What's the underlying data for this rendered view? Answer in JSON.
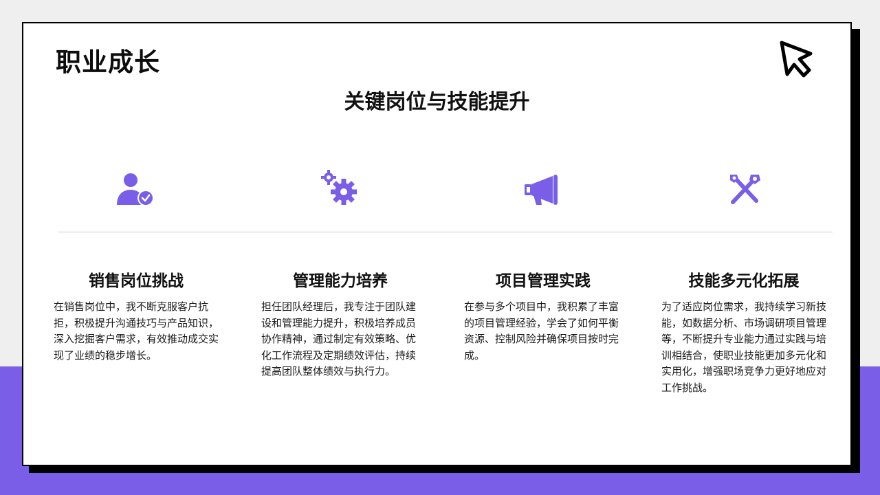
{
  "header": {
    "title": "职业成长",
    "subtitle": "关键岗位与技能提升"
  },
  "icons": [
    "user-check-icon",
    "gears-icon",
    "megaphone-icon",
    "tools-icon",
    "cursor-logo-icon"
  ],
  "colors": {
    "accent": "#7a5ee8",
    "text": "#111111",
    "divider": "#c9c9dc"
  },
  "columns": [
    {
      "title": "销售岗位挑战",
      "body": "在销售岗位中，我不断克服客户抗拒，积极提升沟通技巧与产品知识，深入挖掘客户需求，有效推动成交实现了业绩的稳步增长。"
    },
    {
      "title": "管理能力培养",
      "body": "担任团队经理后，我专注于团队建设和管理能力提升，积极培养成员协作精神，通过制定有效策略、优化工作流程及定期绩效评估，持续提高团队整体绩效与执行力。"
    },
    {
      "title": "项目管理实践",
      "body": "在参与多个项目中，我积累了丰富的项目管理经验，学会了如何平衡资源、控制风险并确保项目按时完成。"
    },
    {
      "title": "技能多元化拓展",
      "body": "为了适应岗位需求，我持续学习新技能，如数据分析、市场调研项目管理等，不断提升专业能力通过实践与培训相结合，使职业技能更加多元化和实用化，增强职场竞争力更好地应对工作挑战。"
    }
  ]
}
